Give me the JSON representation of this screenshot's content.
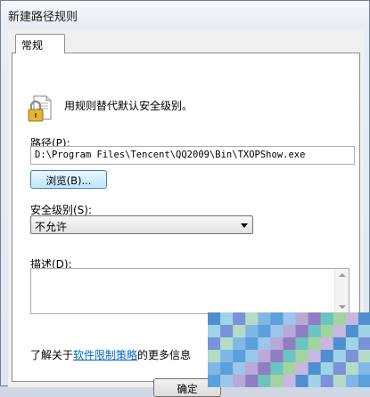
{
  "window": {
    "title": "新建路径规则"
  },
  "tabs": [
    {
      "label": "常规",
      "active": true
    }
  ],
  "general": {
    "description": "用规则替代默认安全级别。",
    "path_label": "路径(P):",
    "path_value": "D:\\Program Files\\Tencent\\QQ2009\\Bin\\TXOPShow.exe",
    "browse_label": "浏览(B)...",
    "level_label": "安全级别(S):",
    "level_value": "不允许",
    "desc_label": "描述(D):",
    "desc_value": "",
    "info_prefix": "了解关于",
    "info_link": "软件限制策略",
    "info_suffix": "的更多信息"
  },
  "buttons": {
    "ok_label": "确定"
  },
  "icons": {
    "rule": "lock-document-icon"
  },
  "colors": {
    "link": "#0066cc",
    "browse_border": "#3c7fb1"
  }
}
